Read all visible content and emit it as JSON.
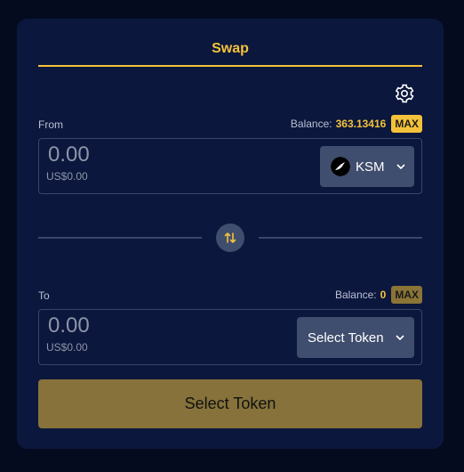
{
  "header": {
    "tab_label": "Swap"
  },
  "settings": {
    "icon": "gear-icon"
  },
  "from": {
    "label": "From",
    "balance_label": "Balance:",
    "balance_value": "363.13416",
    "max_label": "MAX",
    "amount_placeholder": "0.00",
    "usd_value": "US$0.00",
    "token_label": "KSM",
    "token_icon": "kusama-logo-icon"
  },
  "switch": {
    "icon": "swap-arrows-icon"
  },
  "to": {
    "label": "To",
    "balance_label": "Balance:",
    "balance_value": "0",
    "max_label": "MAX",
    "amount_placeholder": "0.00",
    "usd_value": "US$0.00",
    "token_label": "Select Token"
  },
  "submit": {
    "label": "Select Token"
  },
  "colors": {
    "background": "#050b1f",
    "card": "#0b173d",
    "accent": "#f4c23a",
    "submit_disabled": "#86723a",
    "button": "#3f4d6e"
  }
}
